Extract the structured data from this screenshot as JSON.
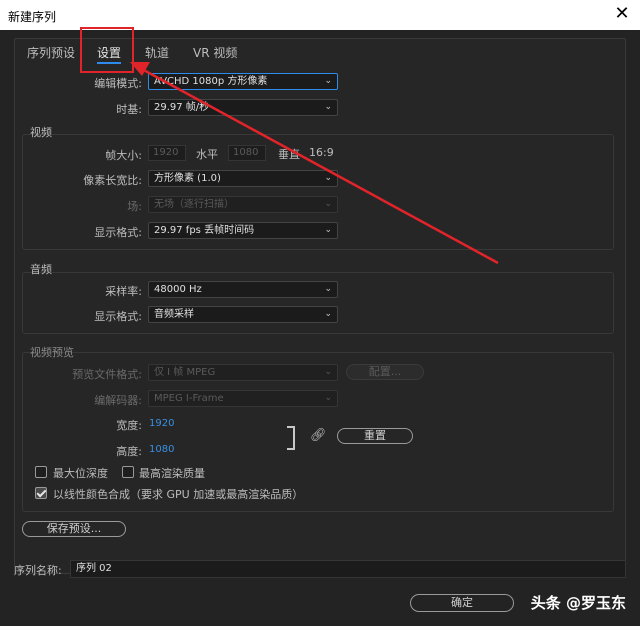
{
  "window": {
    "title": "新建序列"
  },
  "tabs": [
    {
      "label": "序列预设"
    },
    {
      "label": "设置"
    },
    {
      "label": "轨道"
    },
    {
      "label": "VR 视频"
    }
  ],
  "top": {
    "edit_mode_label": "编辑模式:",
    "edit_mode_value": "AVCHD 1080p 方形像素",
    "timebase_label": "时基:",
    "timebase_value": "29.97  帧/秒"
  },
  "video": {
    "title": "视频",
    "frame_size_label": "帧大小:",
    "frame_width": "1920",
    "horizontal_label": "水平",
    "frame_height": "1080",
    "vertical_label": "垂直",
    "aspect": "16:9",
    "pixel_aspect_label": "像素长宽比:",
    "pixel_aspect_value": "方形像素 (1.0)",
    "field_label": "场:",
    "field_value": "无场（逐行扫描）",
    "display_format_label": "显示格式:",
    "display_format_value": "29.97 fps 丢帧时间码"
  },
  "audio": {
    "title": "音频",
    "sample_rate_label": "采样率:",
    "sample_rate_value": "48000 Hz",
    "display_format_label": "显示格式:",
    "display_format_value": "音频采样"
  },
  "preview": {
    "title": "视频预览",
    "file_format_label": "预览文件格式:",
    "file_format_value": "仅 I 帧 MPEG",
    "configure_label": "配置...",
    "codec_label": "编解码器:",
    "codec_value": "MPEG I-Frame",
    "width_label": "宽度:",
    "width_value": "1920",
    "height_label": "高度:",
    "height_value": "1080",
    "reset_label": "重置"
  },
  "options": {
    "max_bit_depth": "最大位深度",
    "max_render_quality": "最高渲染质量",
    "linear_color": "以线性颜色合成（要求 GPU 加速或最高渲染品质）"
  },
  "save_preset_label": "保存预设...",
  "sequence_name_label": "序列名称:",
  "sequence_name_value": "序列 02",
  "ok_label": "确定",
  "watermark": "头条 @罗玉东",
  "colors": {
    "accent": "#2d8ceb",
    "annotation": "#e0242a",
    "value_blue": "#3b8fe0"
  }
}
